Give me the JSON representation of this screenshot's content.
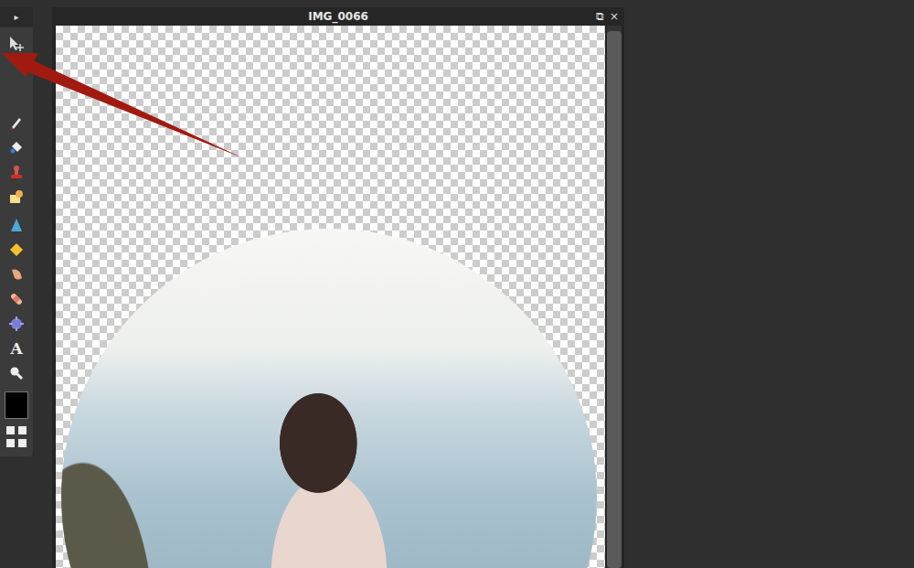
{
  "toolbar": {
    "expand": "▸",
    "tools": [
      {
        "kind": "move",
        "selected": false
      },
      {
        "kind": "pencil",
        "selected": false
      },
      {
        "kind": "bucket",
        "selected": false
      },
      {
        "kind": "stamp",
        "selected": false
      },
      {
        "kind": "replace",
        "selected": false
      },
      {
        "kind": "sharpen",
        "selected": false
      },
      {
        "kind": "sponge",
        "selected": false
      },
      {
        "kind": "smudge",
        "selected": false
      },
      {
        "kind": "heal",
        "selected": false
      },
      {
        "kind": "bloat",
        "selected": false
      },
      {
        "kind": "text",
        "glyph": "A",
        "selected": false
      },
      {
        "kind": "zoom",
        "selected": false
      }
    ],
    "foreground_color": "#000000"
  },
  "document": {
    "title": "IMG_0066",
    "controls": [
      "⧉",
      "×"
    ]
  }
}
